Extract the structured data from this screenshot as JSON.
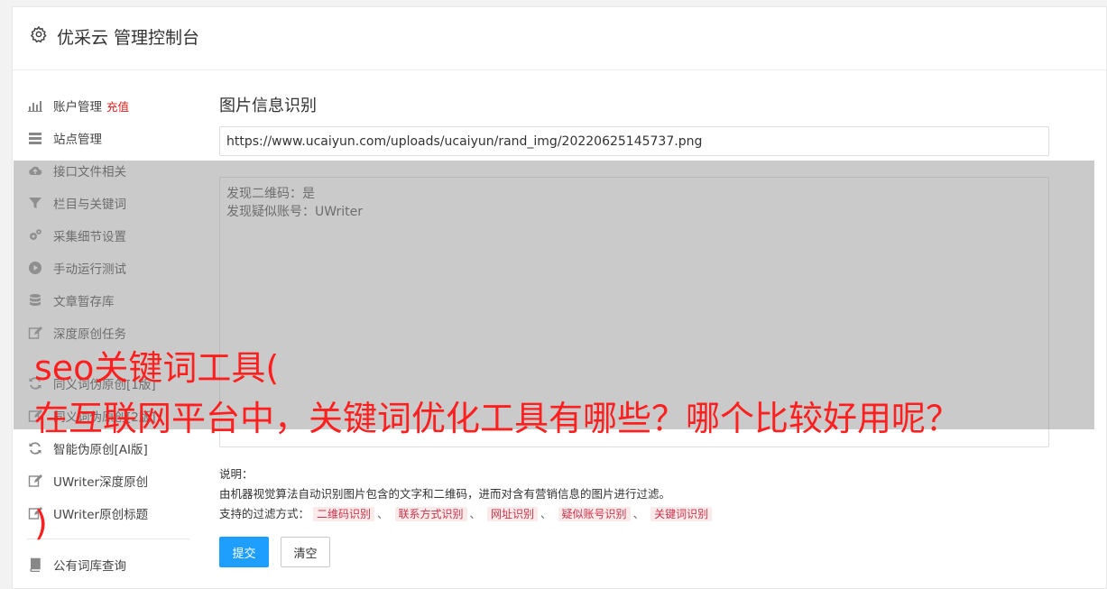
{
  "header": {
    "title": "优采云 管理控制台"
  },
  "sidebar": {
    "items": [
      {
        "label": "账户管理",
        "extra": "充值"
      },
      {
        "label": "站点管理"
      },
      {
        "label": "接口文件相关"
      },
      {
        "label": "栏目与关键词"
      },
      {
        "label": "采集细节设置"
      },
      {
        "label": "手动运行测试"
      },
      {
        "label": "文章暂存库"
      },
      {
        "label": "深度原创任务"
      },
      {
        "label": "同义词伪原创[1版]"
      },
      {
        "label": "同义词伪原创[2版]"
      },
      {
        "label": "智能伪原创[AI版]"
      },
      {
        "label": "UWriter深度原创"
      },
      {
        "label": "UWriter原创标题"
      },
      {
        "label": "公有词库查询"
      }
    ]
  },
  "main": {
    "title": "图片信息识别",
    "url_value": "https://www.ucaiyun.com/uploads/ucaiyun/rand_img/20220625145737.png",
    "result_lines": [
      "发现二维码：是",
      "发现疑似账号：UWriter"
    ],
    "notes_label": "说明：",
    "notes_desc": "由机器视觉算法自动识别图片包含的文字和二维码，进而对含有营销信息的图片进行过滤。",
    "filter_label": "支持的过滤方式：",
    "filter_tags": [
      "二维码识别",
      "联系方式识别",
      "网址识别",
      "疑似账号识别",
      "关键词识别"
    ],
    "separator": "、",
    "submit_label": "提交",
    "clear_label": "清空"
  },
  "overlay": {
    "line1": "seo关键词工具(",
    "line2": "在互联网平台中，关键词优化工具有哪些？哪个比较好用呢？",
    "line3": ")"
  },
  "colors": {
    "accent": "#1e9fff",
    "overlay_text": "#ff1f1f",
    "tag_text": "#c8354d"
  }
}
